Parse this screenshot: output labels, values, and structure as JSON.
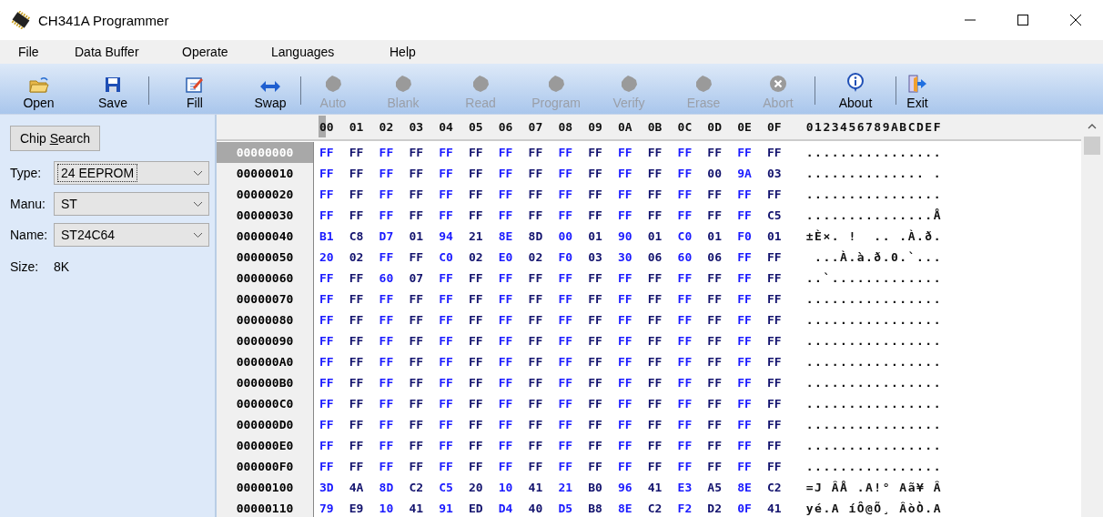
{
  "window": {
    "title": "CH341A Programmer"
  },
  "menu": [
    "File",
    "Data Buffer",
    "Operate",
    "Languages",
    "Help"
  ],
  "toolbar": [
    {
      "kind": "button",
      "label": "Open",
      "disabled": false
    },
    {
      "kind": "button",
      "label": "Save",
      "disabled": false
    },
    {
      "kind": "separator"
    },
    {
      "kind": "button",
      "label": "Fill",
      "disabled": false
    },
    {
      "kind": "button",
      "label": "Swap",
      "disabled": false
    },
    {
      "kind": "separator"
    },
    {
      "kind": "button",
      "label": "Auto",
      "disabled": true
    },
    {
      "kind": "button",
      "label": "Blank",
      "disabled": true
    },
    {
      "kind": "button",
      "label": "Read",
      "disabled": true
    },
    {
      "kind": "button",
      "label": "Program",
      "disabled": true
    },
    {
      "kind": "button",
      "label": "Verify",
      "disabled": true
    },
    {
      "kind": "button",
      "label": "Erase",
      "disabled": true
    },
    {
      "kind": "button",
      "label": "Abort",
      "disabled": true
    },
    {
      "kind": "separator"
    },
    {
      "kind": "button",
      "label": "About",
      "disabled": false
    },
    {
      "kind": "separator"
    },
    {
      "kind": "button",
      "label": "Exit",
      "disabled": false
    }
  ],
  "sidebar": {
    "chip_search": {
      "label": "Chip ",
      "access_key": "S",
      "rest": "earch"
    },
    "fields": [
      {
        "label": "Type:",
        "value": "24 EEPROM",
        "focused": true
      },
      {
        "label": "Manu:",
        "value": "ST",
        "focused": false
      },
      {
        "label": "Name:",
        "value": "ST24C64",
        "focused": false
      }
    ],
    "size": {
      "label": "Size:",
      "value": "8K"
    }
  },
  "hex": {
    "columns": [
      "00",
      "01",
      "02",
      "03",
      "04",
      "05",
      "06",
      "07",
      "08",
      "09",
      "0A",
      "0B",
      "0C",
      "0D",
      "0E",
      "0F"
    ],
    "ascii_header": "0123456789ABCDEF",
    "rows": [
      {
        "address": "00000000",
        "selected": true,
        "bytes": [
          "FF",
          "FF",
          "FF",
          "FF",
          "FF",
          "FF",
          "FF",
          "FF",
          "FF",
          "FF",
          "FF",
          "FF",
          "FF",
          "FF",
          "FF",
          "FF"
        ],
        "ascii": "................"
      },
      {
        "address": "00000010",
        "selected": false,
        "bytes": [
          "FF",
          "FF",
          "FF",
          "FF",
          "FF",
          "FF",
          "FF",
          "FF",
          "FF",
          "FF",
          "FF",
          "FF",
          "FF",
          "00",
          "9A",
          "03"
        ],
        "ascii": ".............. ."
      },
      {
        "address": "00000020",
        "selected": false,
        "bytes": [
          "FF",
          "FF",
          "FF",
          "FF",
          "FF",
          "FF",
          "FF",
          "FF",
          "FF",
          "FF",
          "FF",
          "FF",
          "FF",
          "FF",
          "FF",
          "FF"
        ],
        "ascii": "................"
      },
      {
        "address": "00000030",
        "selected": false,
        "bytes": [
          "FF",
          "FF",
          "FF",
          "FF",
          "FF",
          "FF",
          "FF",
          "FF",
          "FF",
          "FF",
          "FF",
          "FF",
          "FF",
          "FF",
          "FF",
          "C5"
        ],
        "ascii": "...............Å"
      },
      {
        "address": "00000040",
        "selected": false,
        "bytes": [
          "B1",
          "C8",
          "D7",
          "01",
          "94",
          "21",
          "8E",
          "8D",
          "00",
          "01",
          "90",
          "01",
          "C0",
          "01",
          "F0",
          "01"
        ],
        "ascii": "±È×. !  .. .À.ð."
      },
      {
        "address": "00000050",
        "selected": false,
        "bytes": [
          "20",
          "02",
          "FF",
          "FF",
          "C0",
          "02",
          "E0",
          "02",
          "F0",
          "03",
          "30",
          "06",
          "60",
          "06",
          "FF",
          "FF"
        ],
        "ascii": " ...À.à.ð.0.`..."
      },
      {
        "address": "00000060",
        "selected": false,
        "bytes": [
          "FF",
          "FF",
          "60",
          "07",
          "FF",
          "FF",
          "FF",
          "FF",
          "FF",
          "FF",
          "FF",
          "FF",
          "FF",
          "FF",
          "FF",
          "FF"
        ],
        "ascii": "..`............."
      },
      {
        "address": "00000070",
        "selected": false,
        "bytes": [
          "FF",
          "FF",
          "FF",
          "FF",
          "FF",
          "FF",
          "FF",
          "FF",
          "FF",
          "FF",
          "FF",
          "FF",
          "FF",
          "FF",
          "FF",
          "FF"
        ],
        "ascii": "................"
      },
      {
        "address": "00000080",
        "selected": false,
        "bytes": [
          "FF",
          "FF",
          "FF",
          "FF",
          "FF",
          "FF",
          "FF",
          "FF",
          "FF",
          "FF",
          "FF",
          "FF",
          "FF",
          "FF",
          "FF",
          "FF"
        ],
        "ascii": "................"
      },
      {
        "address": "00000090",
        "selected": false,
        "bytes": [
          "FF",
          "FF",
          "FF",
          "FF",
          "FF",
          "FF",
          "FF",
          "FF",
          "FF",
          "FF",
          "FF",
          "FF",
          "FF",
          "FF",
          "FF",
          "FF"
        ],
        "ascii": "................"
      },
      {
        "address": "000000A0",
        "selected": false,
        "bytes": [
          "FF",
          "FF",
          "FF",
          "FF",
          "FF",
          "FF",
          "FF",
          "FF",
          "FF",
          "FF",
          "FF",
          "FF",
          "FF",
          "FF",
          "FF",
          "FF"
        ],
        "ascii": "................"
      },
      {
        "address": "000000B0",
        "selected": false,
        "bytes": [
          "FF",
          "FF",
          "FF",
          "FF",
          "FF",
          "FF",
          "FF",
          "FF",
          "FF",
          "FF",
          "FF",
          "FF",
          "FF",
          "FF",
          "FF",
          "FF"
        ],
        "ascii": "................"
      },
      {
        "address": "000000C0",
        "selected": false,
        "bytes": [
          "FF",
          "FF",
          "FF",
          "FF",
          "FF",
          "FF",
          "FF",
          "FF",
          "FF",
          "FF",
          "FF",
          "FF",
          "FF",
          "FF",
          "FF",
          "FF"
        ],
        "ascii": "................"
      },
      {
        "address": "000000D0",
        "selected": false,
        "bytes": [
          "FF",
          "FF",
          "FF",
          "FF",
          "FF",
          "FF",
          "FF",
          "FF",
          "FF",
          "FF",
          "FF",
          "FF",
          "FF",
          "FF",
          "FF",
          "FF"
        ],
        "ascii": "................"
      },
      {
        "address": "000000E0",
        "selected": false,
        "bytes": [
          "FF",
          "FF",
          "FF",
          "FF",
          "FF",
          "FF",
          "FF",
          "FF",
          "FF",
          "FF",
          "FF",
          "FF",
          "FF",
          "FF",
          "FF",
          "FF"
        ],
        "ascii": "................"
      },
      {
        "address": "000000F0",
        "selected": false,
        "bytes": [
          "FF",
          "FF",
          "FF",
          "FF",
          "FF",
          "FF",
          "FF",
          "FF",
          "FF",
          "FF",
          "FF",
          "FF",
          "FF",
          "FF",
          "FF",
          "FF"
        ],
        "ascii": "................"
      },
      {
        "address": "00000100",
        "selected": false,
        "bytes": [
          "3D",
          "4A",
          "8D",
          "C2",
          "C5",
          "20",
          "10",
          "41",
          "21",
          "B0",
          "96",
          "41",
          "E3",
          "A5",
          "8E",
          "C2"
        ],
        "ascii": "=J ÂÅ .A!° Aã¥ Â"
      },
      {
        "address": "00000110",
        "selected": false,
        "bytes": [
          "79",
          "E9",
          "10",
          "41",
          "91",
          "ED",
          "D4",
          "40",
          "D5",
          "B8",
          "8E",
          "C2",
          "F2",
          "D2",
          "0F",
          "41"
        ],
        "ascii": "yé.A íÔ@Õ¸ ÂòÒ.A"
      }
    ]
  }
}
